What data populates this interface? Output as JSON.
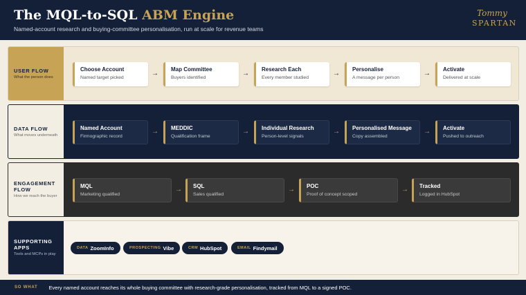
{
  "header": {
    "title_main": "The MQL-to-SQL ",
    "title_accent": "ABM Engine",
    "subtitle": "Named-account research and buying-committee personalisation, run at scale for revenue teams",
    "logo_line1": "Tommy",
    "logo_line2": "SPARTAN"
  },
  "rows": [
    {
      "title": "USER FLOW",
      "subtitle": "What the person does",
      "steps": [
        {
          "title": "Choose Account",
          "sub": "Named target picked"
        },
        {
          "title": "Map Committee",
          "sub": "Buyers identified"
        },
        {
          "title": "Research Each",
          "sub": "Every member studied"
        },
        {
          "title": "Personalise",
          "sub": "A message per person"
        },
        {
          "title": "Activate",
          "sub": "Delivered at scale"
        }
      ]
    },
    {
      "title": "DATA FLOW",
      "subtitle": "What moves underneath",
      "steps": [
        {
          "title": "Named Account",
          "sub": "Firmographic record"
        },
        {
          "title": "MEDDIC",
          "sub": "Qualification frame"
        },
        {
          "title": "Individual Research",
          "sub": "Person-level signals"
        },
        {
          "title": "Personalised Message",
          "sub": "Copy assembled"
        },
        {
          "title": "Activate",
          "sub": "Pushed to outreach"
        }
      ]
    },
    {
      "title": "ENGAGEMENT FLOW",
      "subtitle": "How we reach the buyer",
      "steps": [
        {
          "title": "MQL",
          "sub": "Marketing qualified"
        },
        {
          "title": "SQL",
          "sub": "Sales qualified"
        },
        {
          "title": "POC",
          "sub": "Proof of concept scoped"
        },
        {
          "title": "Tracked",
          "sub": "Logged in HubSpot"
        }
      ]
    },
    {
      "title": "SUPPORTING APPS",
      "subtitle": "Tools and MCPs in play",
      "apps": [
        {
          "kind": "DATA",
          "name": "ZoomInfo"
        },
        {
          "kind": "PROSPECTING",
          "name": "Vibe"
        },
        {
          "kind": "CRM",
          "name": "HubSpot"
        },
        {
          "kind": "EMAIL",
          "name": "Findymail"
        }
      ]
    }
  ],
  "arrow_glyph": "→",
  "footer": {
    "label": "SO WHAT",
    "text": "Every named account reaches its whole buying committee with research-grade personalisation, tracked from MQL to a signed POC."
  },
  "colors": {
    "navy": "#141f38",
    "gold": "#c7a455",
    "cream": "#f3eee3",
    "charcoal": "#2b2b2b"
  }
}
